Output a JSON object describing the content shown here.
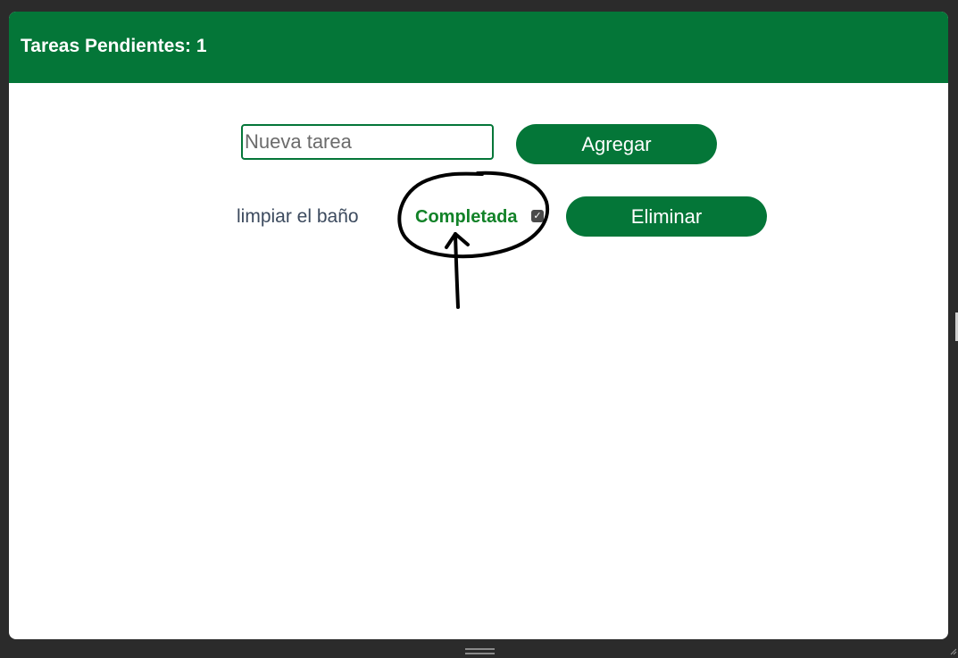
{
  "header": {
    "title": "Tareas Pendientes: 1",
    "color": "#047638"
  },
  "new_task": {
    "placeholder": "Nueva tarea",
    "value": "",
    "add_label": "Agregar"
  },
  "tasks": [
    {
      "text": "limpiar el baño",
      "status_label": "Completada",
      "completed": true,
      "delete_label": "Eliminar"
    }
  ],
  "colors": {
    "accent": "#047638",
    "completed_text": "#128228",
    "task_text": "#3c4a5e",
    "annotation": "#000000"
  },
  "icons": {
    "checkbox": "check-icon",
    "annotation": "hand-drawn-circle-and-arrow"
  }
}
